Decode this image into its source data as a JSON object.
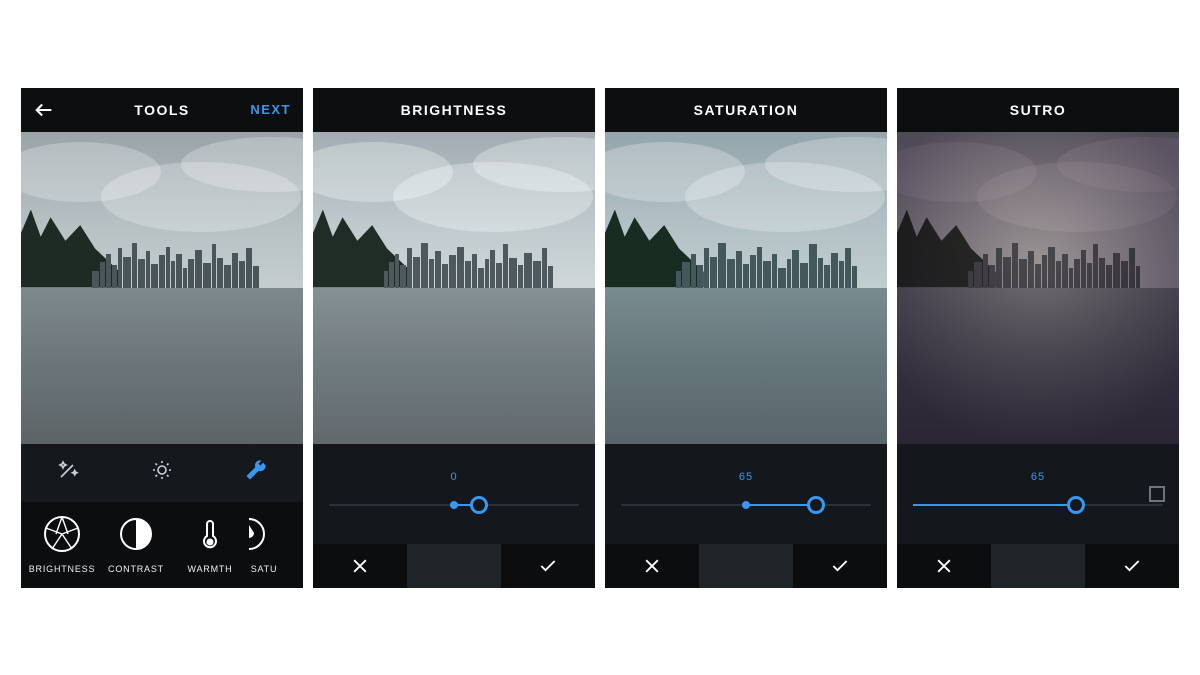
{
  "colors": {
    "accent": "#3897f0"
  },
  "screens": [
    {
      "id": "tools",
      "header": {
        "title": "TOOLS",
        "next": "NEXT",
        "hasBack": true
      },
      "toolIcons": [
        "magic-wand-icon",
        "auto-enhance-icon",
        "wrench-icon"
      ],
      "toolStrip": [
        {
          "label": "BRIGHTNESS",
          "icon": "aperture-icon"
        },
        {
          "label": "CONTRAST",
          "icon": "contrast-icon"
        },
        {
          "label": "WARMTH",
          "icon": "thermometer-icon"
        },
        {
          "label": "SATU",
          "icon": "droplet-icon",
          "cut": true
        }
      ]
    },
    {
      "id": "brightness",
      "header": {
        "title": "BRIGHTNESS"
      },
      "slider": {
        "value": 0,
        "thumbPct": 60,
        "centerPct": 50,
        "fillFromPct": 50,
        "fillToPct": 60
      }
    },
    {
      "id": "saturation",
      "header": {
        "title": "SATURATION"
      },
      "slider": {
        "value": 65,
        "thumbPct": 78,
        "centerPct": 50,
        "fillFromPct": 50,
        "fillToPct": 78
      }
    },
    {
      "id": "sutro",
      "header": {
        "title": "SUTRO"
      },
      "slider": {
        "value": 65,
        "thumbPct": 65,
        "fillFromPct": 0,
        "fillToPct": 65,
        "hasBorderToggle": true
      }
    }
  ]
}
